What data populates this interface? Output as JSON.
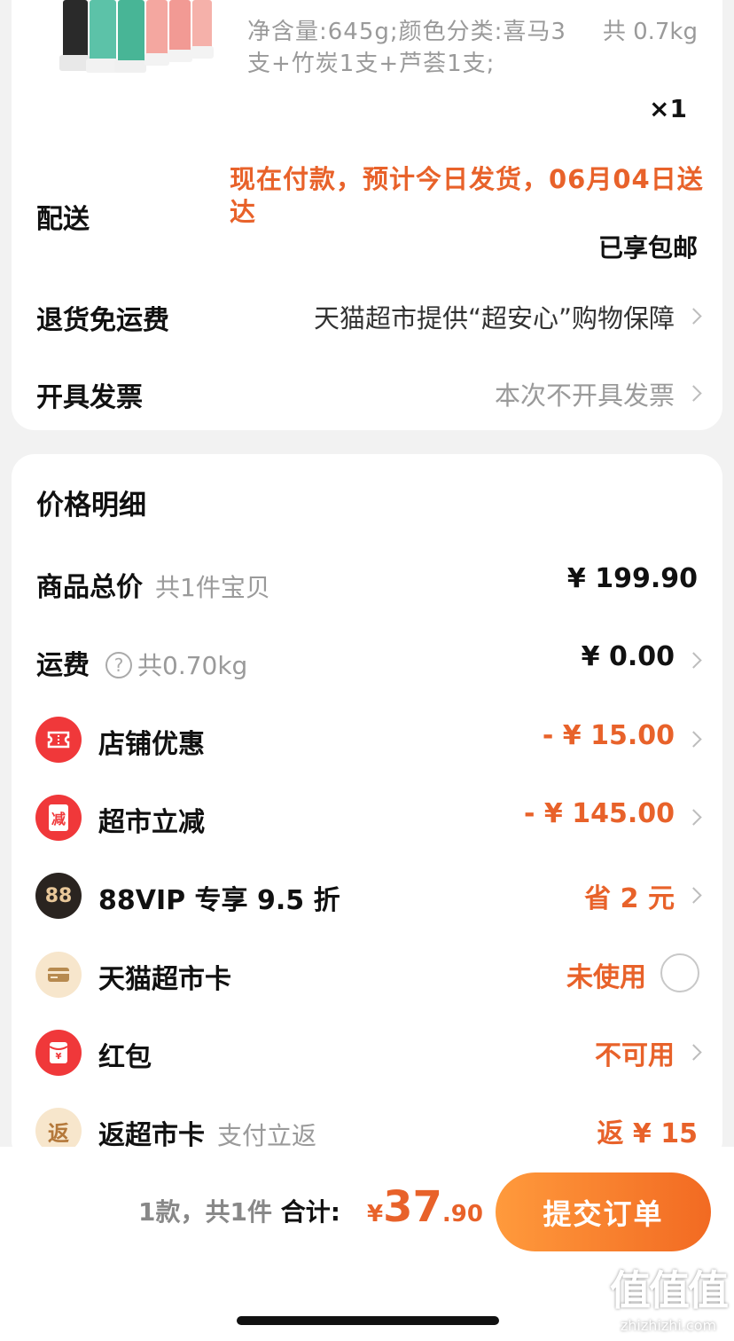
{
  "product": {
    "spec": "净含量:645g;颜色分类:喜马3支+竹炭1支+芦荟1支;",
    "weight": "共 0.7kg",
    "quantity": "×1"
  },
  "delivery": {
    "label": "配送",
    "note": "现在付款，预计今日发货，06月04日送达",
    "free_shipping": "已享包邮"
  },
  "return_shipping": {
    "label": "退货免运费",
    "value": "天猫超市提供“超安心”购物保障"
  },
  "invoice": {
    "label": "开具发票",
    "value": "本次不开具发票"
  },
  "price_detail": {
    "title": "价格明细",
    "rows": [
      {
        "label": "商品总价",
        "sub": "共1件宝贝",
        "value": "¥ 199.90"
      },
      {
        "label": "运费",
        "sub": "共0.70kg",
        "value": "¥ 0.00",
        "help": "?"
      },
      {
        "label": "店铺优惠",
        "value": "- ¥ 15.00",
        "icon": "coupon-icon"
      },
      {
        "label": "超市立减",
        "value": "- ¥ 145.00",
        "icon": "discount-icon",
        "icon_text": "减"
      },
      {
        "label": "88VIP 专享 9.5 折",
        "value": "省 2 元",
        "icon": "vip-88-icon",
        "icon_text": "88"
      },
      {
        "label": "天猫超市卡",
        "value": "未使用",
        "icon": "card-icon"
      },
      {
        "label": "红包",
        "value": "不可用",
        "icon": "red-envelope-icon"
      },
      {
        "label": "返超市卡",
        "sub": "支付立返",
        "value": "返 ¥ 15",
        "icon": "rebate-icon",
        "icon_text": "返"
      }
    ]
  },
  "footer": {
    "summary_count": "1款，共1件",
    "summary_total_label": "合计:",
    "total_currency": "¥",
    "total_int": "37",
    "total_dec": ".90",
    "submit_label": "提交订单"
  },
  "watermark": {
    "text": "值值值",
    "url": "zhizhizhi.com"
  },
  "colors": {
    "accent": "#e8622a",
    "button_start": "#ff9a3c",
    "button_end": "#f26a22"
  }
}
